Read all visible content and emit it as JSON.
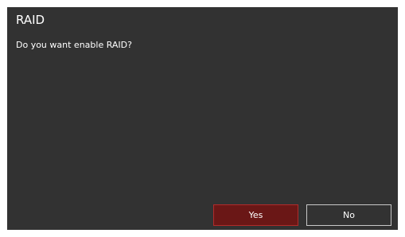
{
  "dialog": {
    "title": "RAID",
    "message": "Do you want enable RAID?",
    "buttons": {
      "yes_label": "Yes",
      "no_label": "No"
    }
  },
  "colors": {
    "dialog_background": "#323232",
    "primary_button": "#6a1716",
    "primary_button_border": "#b12b2a",
    "text": "#ffffff"
  }
}
